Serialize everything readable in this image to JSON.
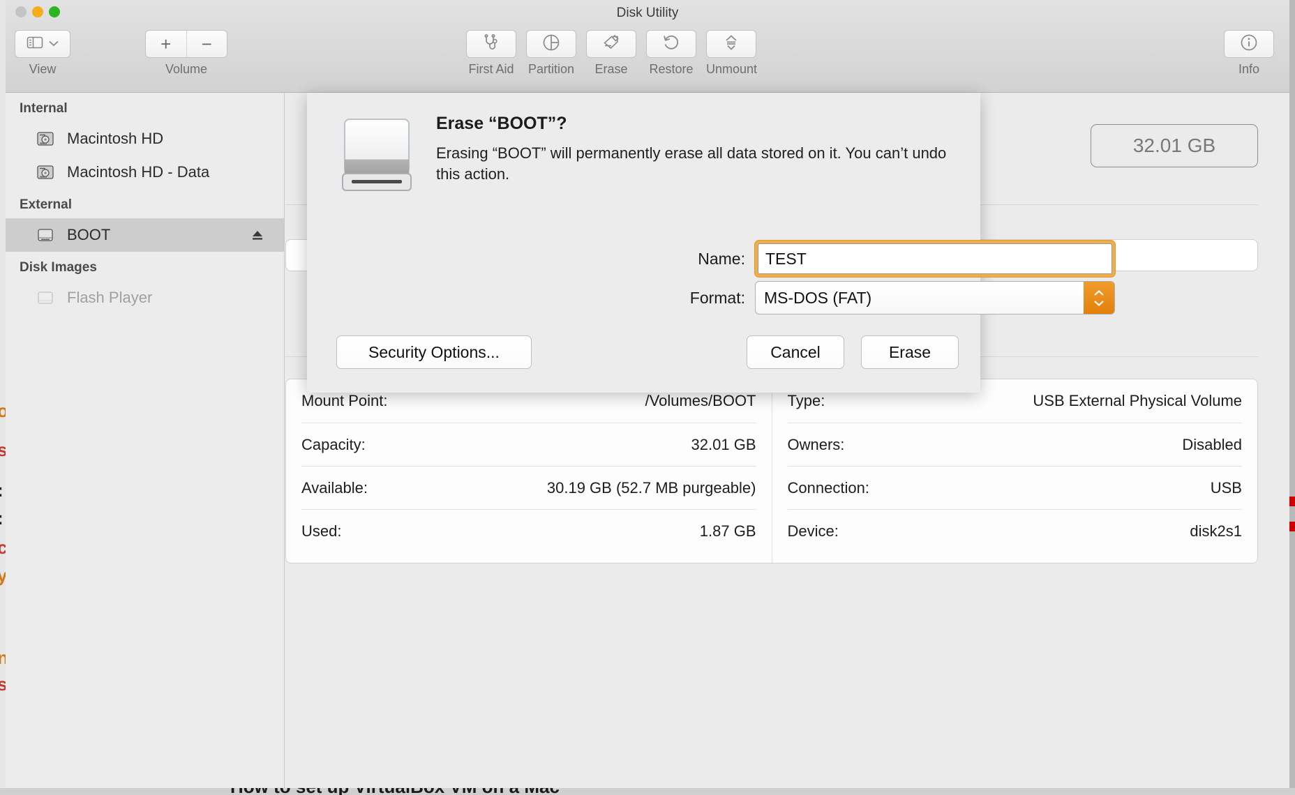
{
  "window": {
    "title": "Disk Utility"
  },
  "traffic_lights": {
    "close": "close-button",
    "minimize": "minimize-button",
    "zoom": "zoom-button"
  },
  "toolbar": {
    "view_label": "View",
    "volume_label": "Volume",
    "volume_add": "+",
    "volume_remove": "−",
    "items": [
      {
        "label": "First Aid",
        "icon": "stethoscope-icon"
      },
      {
        "label": "Partition",
        "icon": "partition-pie-icon"
      },
      {
        "label": "Erase",
        "icon": "erase-pencil-icon"
      },
      {
        "label": "Restore",
        "icon": "restore-undo-icon"
      },
      {
        "label": "Unmount",
        "icon": "unmount-eject-icon"
      }
    ],
    "info_label": "Info"
  },
  "sidebar": {
    "sections": [
      {
        "header": "Internal",
        "items": [
          {
            "label": "Macintosh HD",
            "icon": "internal-drive-icon",
            "selected": false,
            "dim": false,
            "eject": false
          },
          {
            "label": "Macintosh HD - Data",
            "icon": "internal-drive-icon",
            "selected": false,
            "dim": false,
            "eject": false
          }
        ]
      },
      {
        "header": "External",
        "items": [
          {
            "label": "BOOT",
            "icon": "external-drive-icon",
            "selected": true,
            "dim": false,
            "eject": true
          }
        ]
      },
      {
        "header": "Disk Images",
        "items": [
          {
            "label": "Flash Player",
            "icon": "disk-image-icon",
            "selected": false,
            "dim": true,
            "eject": false
          }
        ]
      }
    ]
  },
  "content": {
    "capacity_badge": "32.01 GB",
    "info_left": [
      {
        "key": "Mount Point:",
        "value": "/Volumes/BOOT"
      },
      {
        "key": "Capacity:",
        "value": "32.01 GB"
      },
      {
        "key": "Available:",
        "value": "30.19 GB (52.7 MB purgeable)"
      },
      {
        "key": "Used:",
        "value": "1.87 GB"
      }
    ],
    "info_right": [
      {
        "key": "Type:",
        "value": "USB External Physical Volume"
      },
      {
        "key": "Owners:",
        "value": "Disabled"
      },
      {
        "key": "Connection:",
        "value": "USB"
      },
      {
        "key": "Device:",
        "value": "disk2s1"
      }
    ]
  },
  "dialog": {
    "title": "Erase “BOOT”?",
    "message": "Erasing “BOOT” will permanently erase all data stored on it. You can’t undo this action.",
    "name_label": "Name:",
    "name_value": "TEST",
    "format_label": "Format:",
    "format_value": "MS-DOS (FAT)",
    "security_button": "Security Options...",
    "cancel_button": "Cancel",
    "erase_button": "Erase"
  },
  "background_bleed": {
    "bottom_text": "How to set up VirtualBox VM on a Mac"
  },
  "colors": {
    "accent_orange": "#e3800c",
    "focus_ring": "#f0ae4a",
    "selection_gray": "#cdcdcd",
    "window_bg": "#ebebeb"
  }
}
